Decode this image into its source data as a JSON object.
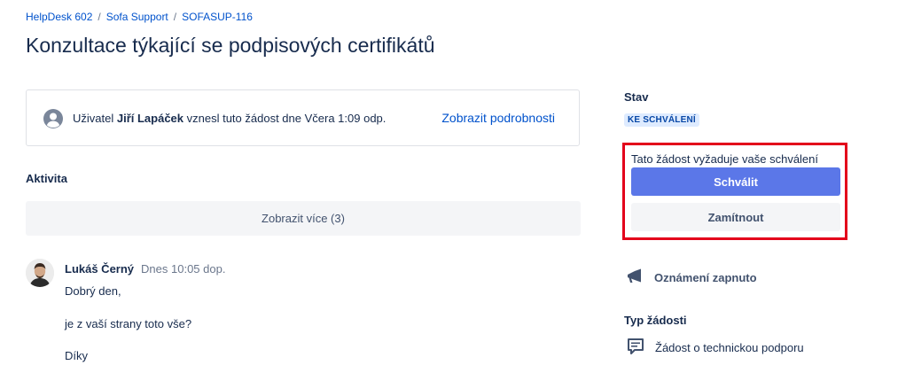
{
  "breadcrumb": {
    "items": [
      "HelpDesk 602",
      "Sofa Support",
      "SOFASUP-116"
    ],
    "separator": "/"
  },
  "page": {
    "title": "Konzultace týkající se podpisových certifikátů"
  },
  "request_card": {
    "prefix": "Uživatel ",
    "user": "Jiří Lapáček",
    "suffix": " vznesl tuto žádost dne Včera 1:09 odp.",
    "details_link": "Zobrazit podrobnosti",
    "icon": "user-avatar-icon"
  },
  "activity": {
    "label": "Aktivita",
    "show_more": "Zobrazit více (3)",
    "comment": {
      "author": "Lukáš Černý",
      "time": "Dnes 10:05 dop.",
      "lines": [
        "Dobrý den,",
        "je z vaší strany toto vše?",
        "Díky"
      ]
    }
  },
  "sidebar": {
    "status_label": "Stav",
    "status_value": "KE SCHVÁLENÍ",
    "approval_text": "Tato žádost vyžaduje vaše schválení",
    "approve_label": "Schválit",
    "decline_label": "Zamítnout",
    "notification_label": "Oznámení zapnuto",
    "notification_icon": "megaphone-icon",
    "request_type_label": "Typ žádosti",
    "request_type_value": "Žádost o technickou podporu",
    "request_type_icon": "comment-icon"
  },
  "colors": {
    "link": "#0052cc",
    "primary_button": "#5b77e8",
    "highlight_border": "#e3001b",
    "status_badge_bg": "#deebff",
    "status_badge_text": "#0747a6"
  }
}
